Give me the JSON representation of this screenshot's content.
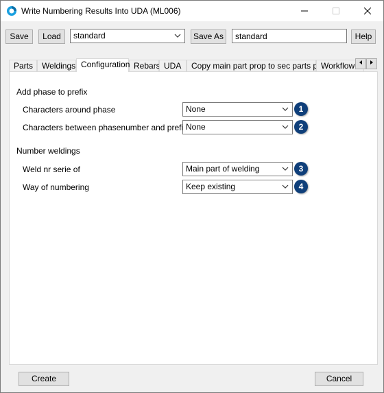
{
  "window": {
    "title": "Write Numbering Results Into UDA (ML006)"
  },
  "toolbar": {
    "save_label": "Save",
    "load_label": "Load",
    "preset_value": "standard",
    "save_as_label": "Save As",
    "save_as_value": "standard",
    "help_label": "Help"
  },
  "tabs": [
    {
      "label": "Parts"
    },
    {
      "label": "Weldings"
    },
    {
      "label": "Configuration"
    },
    {
      "label": "Rebars"
    },
    {
      "label": "UDA"
    },
    {
      "label": "Copy main part prop to sec parts prop"
    },
    {
      "label": "Workflow-s"
    }
  ],
  "active_tab": "Configuration",
  "section_phase": {
    "heading": "Add phase to prefix",
    "rows": [
      {
        "label": "Characters around phase",
        "value": "None",
        "badge": "1"
      },
      {
        "label": "Characters between phasenumber and prefix",
        "value": "None",
        "badge": "2"
      }
    ]
  },
  "section_weld": {
    "heading": "Number weldings",
    "rows": [
      {
        "label": "Weld nr serie of",
        "value": "Main part of welding",
        "badge": "3"
      },
      {
        "label": "Way of numbering",
        "value": "Keep existing",
        "badge": "4"
      }
    ]
  },
  "footer": {
    "create_label": "Create",
    "cancel_label": "Cancel"
  },
  "colors": {
    "badge": "#0f3f7a",
    "window_bg": "#f0f0f0",
    "panel_bg": "#ffffff"
  }
}
